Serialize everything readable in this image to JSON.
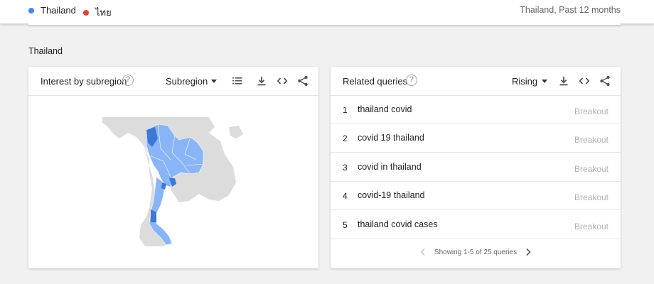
{
  "legend": {
    "items": [
      {
        "label": "Thailand",
        "color": "#4285f4"
      },
      {
        "label": "ไทย",
        "color": "#db4437"
      }
    ],
    "context": "Thailand, Past 12 months"
  },
  "section_title": "Thailand",
  "interest_card": {
    "title": "Interest by subregion",
    "selector": "Subregion",
    "icons": [
      "help-icon",
      "list-icon",
      "download-icon",
      "embed-icon",
      "share-icon"
    ]
  },
  "related_card": {
    "title": "Related queries",
    "selector": "Rising",
    "icons": [
      "help-icon",
      "download-icon",
      "embed-icon",
      "share-icon"
    ],
    "queries": [
      {
        "rank": "1",
        "query": "thailand covid",
        "value": "Breakout"
      },
      {
        "rank": "2",
        "query": "covid 19 thailand",
        "value": "Breakout"
      },
      {
        "rank": "3",
        "query": "covid in thailand",
        "value": "Breakout"
      },
      {
        "rank": "4",
        "query": "covid-19 thailand",
        "value": "Breakout"
      },
      {
        "rank": "5",
        "query": "thailand covid cases",
        "value": "Breakout"
      }
    ],
    "pagination": "Showing 1-5 of 25 queries"
  },
  "colors": {
    "map_land": "#dcdcdc",
    "map_light_blue": "#8ab4f8",
    "map_dark_blue": "#3d78d8"
  }
}
